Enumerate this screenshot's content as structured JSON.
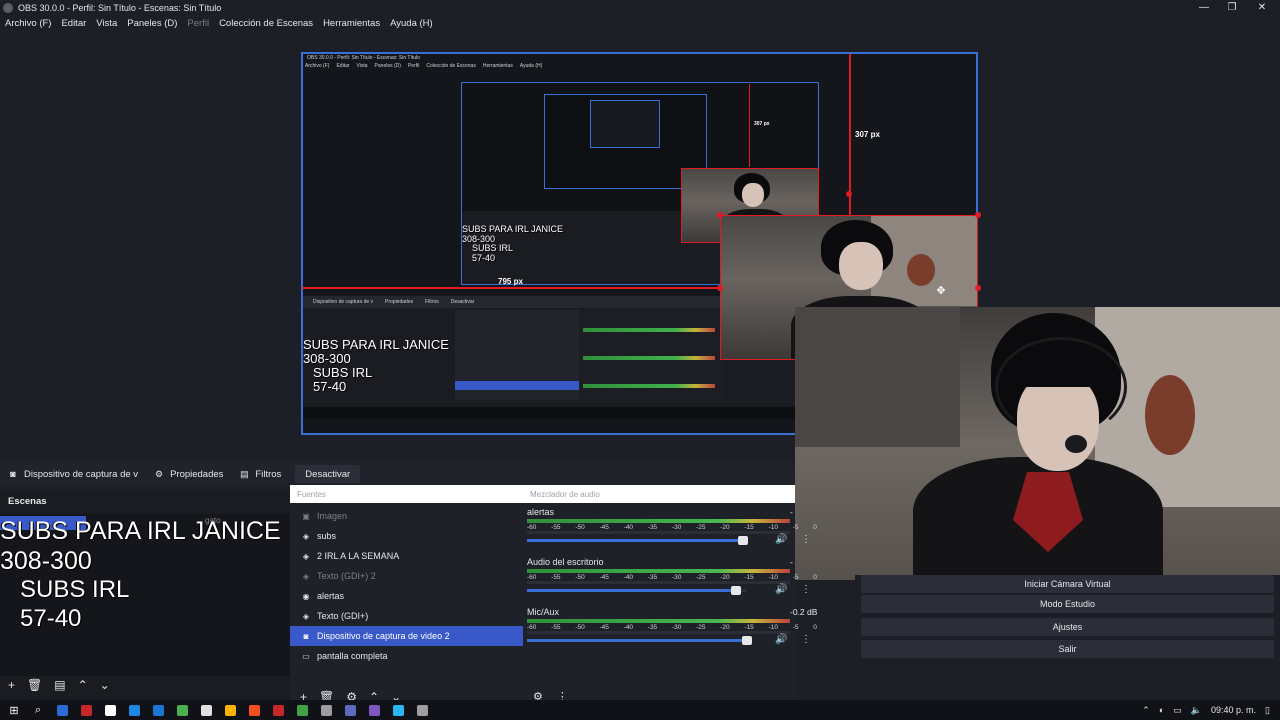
{
  "window": {
    "title": "OBS 30.0.0 - Perfil: Sin Título - Escenas: Sin Título",
    "minimize": "—",
    "restore": "❐",
    "close": "✕"
  },
  "menu": [
    {
      "label": "Archivo (F)",
      "disabled": false
    },
    {
      "label": "Editar",
      "disabled": false
    },
    {
      "label": "Vista",
      "disabled": false
    },
    {
      "label": "Paneles (D)",
      "disabled": false
    },
    {
      "label": "Perfil",
      "disabled": true
    },
    {
      "label": "Colección de Escenas",
      "disabled": false
    },
    {
      "label": "Herramientas",
      "disabled": false
    },
    {
      "label": "Ayuda (H)",
      "disabled": false
    }
  ],
  "preview": {
    "measure_top": "307 px",
    "measure_left": "795 px",
    "measure_mini": "307 px",
    "nested_title": "OBS 30.0.0 - Perfil: Sin Título - Escenas: Sin Título",
    "nested_menu": [
      "Archivo (F)",
      "Editar",
      "Vista",
      "Paneles (D)",
      "Perfil",
      "Colección de Escenas",
      "Herramientas",
      "Ayuda (H)"
    ],
    "nested_dock_tabs": [
      "Dispositivo de captura de v",
      "Propiedades",
      "Filtros",
      "Desactivar"
    ],
    "nested_overlay": [
      "SUBS PARA IRL JANICE",
      "308-300",
      "SUBS IRL",
      "57-40"
    ],
    "nested_overlay_small": [
      "SUBS PARA IRL JANICE",
      "308-300",
      "SUBS IRL",
      "57-40"
    ]
  },
  "toolbar": {
    "source_name": "Dispositivo de captura de v",
    "properties": "Propiedades",
    "filters": "Filtros",
    "deactivate": "Desactivar"
  },
  "scenes": {
    "title": "Escenas",
    "hidden_label": "gato",
    "overlay": {
      "line1": "SUBS PARA IRL JANICE",
      "line2": "308-300",
      "line3": "SUBS IRL",
      "line4": "57-40"
    }
  },
  "sources": {
    "header": "Fuentes",
    "items": [
      {
        "label": "Imagen",
        "icon": "image-icon",
        "glyph": "▣",
        "state": "dim"
      },
      {
        "label": "subs",
        "icon": "audio-icon",
        "glyph": "◈",
        "state": ""
      },
      {
        "label": "2 IRL A LA SEMANA",
        "icon": "audio-icon",
        "glyph": "◈",
        "state": ""
      },
      {
        "label": "Texto (GDI+) 2",
        "icon": "text-icon",
        "glyph": "◈",
        "state": "dim"
      },
      {
        "label": "alertas",
        "icon": "browser-icon",
        "glyph": "◉",
        "state": ""
      },
      {
        "label": "Texto (GDI+)",
        "icon": "text-icon",
        "glyph": "◈",
        "state": ""
      },
      {
        "label": "Dispositivo de captura de video 2",
        "icon": "camera-icon",
        "glyph": "◙",
        "state": "sel"
      },
      {
        "label": "pantalla completa",
        "icon": "monitor-icon",
        "glyph": "▭",
        "state": ""
      }
    ]
  },
  "mixer": {
    "header": "Mezclador de audio",
    "channels": [
      {
        "name": "alertas",
        "db": "-",
        "volume": 0.98
      },
      {
        "name": "Audio del escritorio",
        "db": "-",
        "volume": 0.95
      },
      {
        "name": "Mic/Aux",
        "db": "-0.2 dB",
        "volume": 1.0
      }
    ],
    "ticks": [
      "-60",
      "-55",
      "-50",
      "-45",
      "-40",
      "-35",
      "-30",
      "-25",
      "-20",
      "-15",
      "-10",
      "-5",
      "0"
    ]
  },
  "controls": {
    "virtual_camera": "Iniciar Cámara Virtual",
    "studio_mode": "Modo Estudio",
    "settings": "Ajustes",
    "exit": "Salir"
  },
  "taskbar": {
    "clock": "09:40 p. m.",
    "app_colors": [
      "#2d6ad8",
      "#c62828",
      "#ffffff",
      "#1e88e5",
      "#1976d2",
      "#4caf50",
      "#e0e0e0",
      "#ffb300",
      "#f4511e",
      "#c62828",
      "#43a047",
      "#9e9e9e",
      "#5c6bc0",
      "#7e57c2",
      "#29b6f6",
      "#9e9e9e"
    ]
  }
}
